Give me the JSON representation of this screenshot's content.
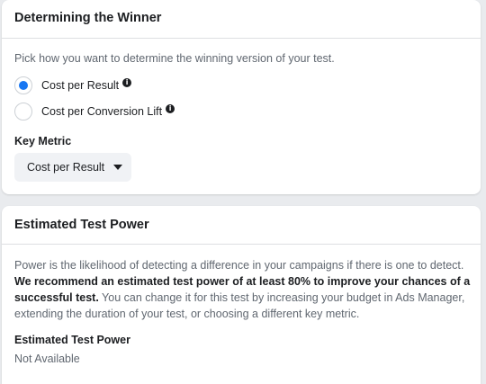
{
  "winner": {
    "title": "Determining the Winner",
    "description": "Pick how you want to determine the winning version of your test.",
    "options": [
      {
        "label": "Cost per Result",
        "selected": true
      },
      {
        "label": "Cost per Conversion Lift",
        "selected": false
      }
    ],
    "info_icon": "info-circle-icon",
    "key_metric_label": "Key Metric",
    "key_metric_value": "Cost per Result"
  },
  "power": {
    "title": "Estimated Test Power",
    "paragraph_part1": "Power is the likelihood of detecting a difference in your campaigns if there is one to detect.",
    "paragraph_bold": "We recommend an estimated test power of at least 80% to improve your chances of a successful test.",
    "paragraph_part2": "You can change it for this test by increasing your budget in Ads Manager, extending the duration of your test, or choosing a different key metric.",
    "estimated_label": "Estimated Test Power",
    "estimated_value": "Not Available"
  },
  "colors": {
    "accent": "#1877f2",
    "background": "#e9ebee",
    "card": "#ffffff",
    "muted_text": "#606770",
    "dropdown_bg": "#f0f2f5"
  }
}
